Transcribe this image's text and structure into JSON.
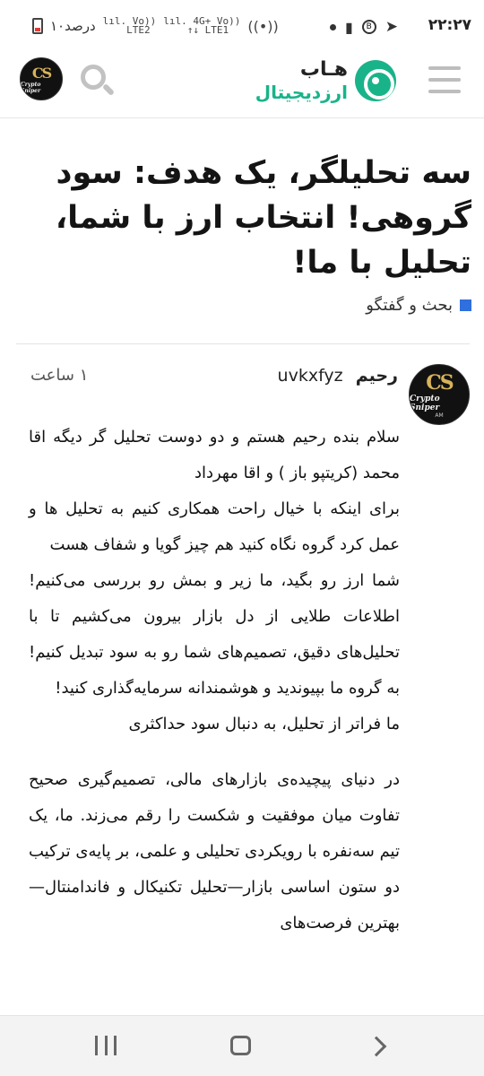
{
  "status_bar": {
    "time": "۲۲:۲۷",
    "battery_text": "۱۰درصد",
    "signal1": "Vo))\nLTE2",
    "signal2": "4G+ Vo))\n↑↓ LTE1"
  },
  "header": {
    "logo_top": "هـاب",
    "logo_bottom": "ارزدیجیتال",
    "accent_color": "#19b38a"
  },
  "article": {
    "title": "سه تحلیلگر، یک هدف: سود گروهی! انتخاب ارز با شما، تحلیل با ما!",
    "category": "بحث و گفتگو",
    "author_name": "رحیم",
    "author_username": "uvkxfyz",
    "timestamp": "۱ ساعت",
    "paragraphs": [
      "سلام بنده رحیم هستم و دو دوست تحلیل گر دیگه اقا محمد (کریتپو باز ) و اقا مهرداد",
      "برای اینکه با خیال راحت همکاری کنیم به تحلیل ها و عمل کرد گروه نگاه کنید هم چیز گویا و شفاف هست",
      "شما ارز رو بگید، ما زیر و بمش رو بررسی می‌کنیم! اطلاعات طلایی از دل بازار بیرون می‌کشیم تا با تحلیل‌های دقیق، تصمیم‌های شما رو به سود تبدیل کنیم! به گروه ما بپیوندید و هوشمندانه سرمایه‌گذاری کنید!",
      "ما فراتر از تحلیل، به دنبال سود حداکثری",
      "در دنیای پیچیده‌ی بازارهای مالی، تصمیم‌گیری صحیح تفاوت میان موفقیت و شکست را رقم می‌زند. ما، یک تیم سه‌نفره با رویکردی تحلیلی و علمی، بر پایه‌ی ترکیب دو ستون اساسی بازار—تحلیل تکنیکال و فاندامنتال—بهترین فرصت‌های"
    ]
  },
  "avatar": {
    "monogram": "CS",
    "label": "Crypto Sniper",
    "sub": "AM"
  }
}
